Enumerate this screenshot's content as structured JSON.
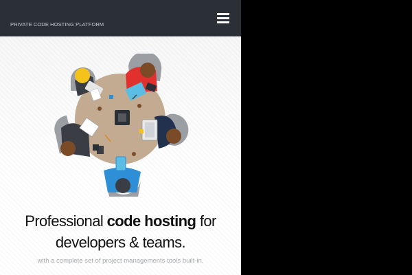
{
  "navbar": {
    "brand": "PRIVATE CODE HOSTING PLATFORM",
    "menu_icon": "hamburger-menu-icon",
    "background": "#2b2f36"
  },
  "hero": {
    "illustration": "team-meeting-table-illustration",
    "headline": {
      "part1": "Professional ",
      "bold": "code hosting",
      "part2": " for",
      "line2": "developers & teams."
    },
    "subline": "with a complete set of project managements tools built-in."
  },
  "colors": {
    "table": "#c2ab91",
    "chair": "#9b9ea3",
    "person_yellow": "#f4c21b",
    "person_red": "#e0312f",
    "person_blue": "#2e8fd6",
    "person_dark": "#3a3d44",
    "person_navy": "#22314d"
  }
}
